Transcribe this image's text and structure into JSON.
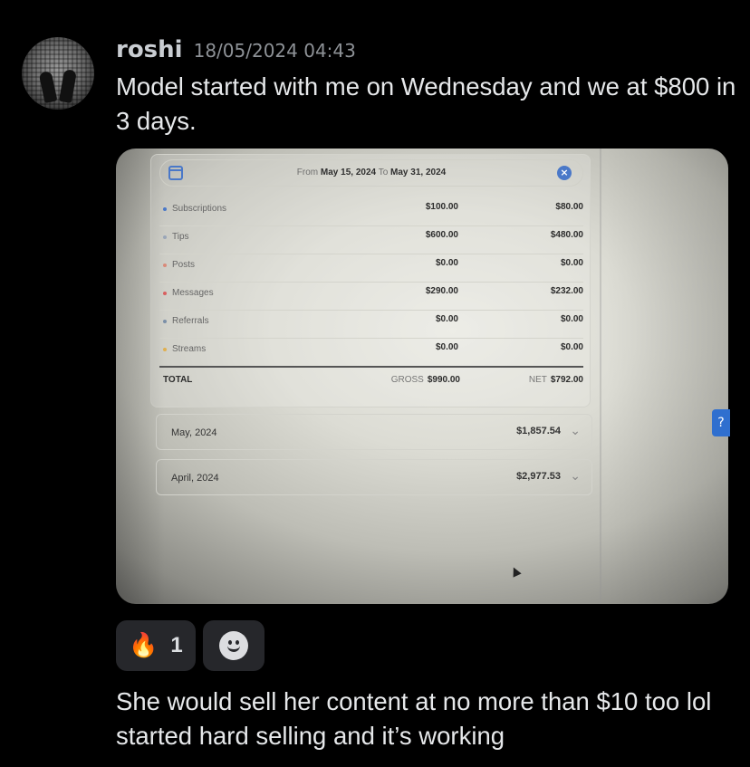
{
  "message": {
    "username": "roshi",
    "timestamp": "18/05/2024 04:43",
    "text": "Model started with me on Wednesday and we at $800 in 3 days.",
    "followup_text": "She would sell her content at no more than $10 too lol started hard selling and it’s working"
  },
  "attachment": {
    "date_range": {
      "from_label": "From",
      "from": "May 15, 2024",
      "to_label": "To",
      "to": "May 31, 2024"
    },
    "rows": [
      {
        "label": "Subscriptions",
        "gross": "$100.00",
        "net": "$80.00",
        "dot_color": "#4a78c8"
      },
      {
        "label": "Tips",
        "gross": "$600.00",
        "net": "$480.00",
        "dot_color": "#9aa6b8"
      },
      {
        "label": "Posts",
        "gross": "$0.00",
        "net": "$0.00",
        "dot_color": "#d98a7a"
      },
      {
        "label": "Messages",
        "gross": "$290.00",
        "net": "$232.00",
        "dot_color": "#d86060"
      },
      {
        "label": "Referrals",
        "gross": "$0.00",
        "net": "$0.00",
        "dot_color": "#7b8fa8"
      },
      {
        "label": "Streams",
        "gross": "$0.00",
        "net": "$0.00",
        "dot_color": "#e0b050"
      }
    ],
    "total": {
      "label": "TOTAL",
      "gross_label": "GROSS",
      "gross": "$990.00",
      "net_label": "NET",
      "net": "$792.00"
    },
    "months": [
      {
        "label": "May, 2024",
        "value": "$1,857.54"
      },
      {
        "label": "April, 2024",
        "value": "$2,977.53"
      }
    ]
  },
  "reactions": [
    {
      "emoji": "🔥",
      "icon": "fire-icon",
      "count": "1"
    }
  ],
  "colors": {
    "accent": "#4a78c8",
    "background": "#000000",
    "reaction_bg": "#26272b"
  }
}
